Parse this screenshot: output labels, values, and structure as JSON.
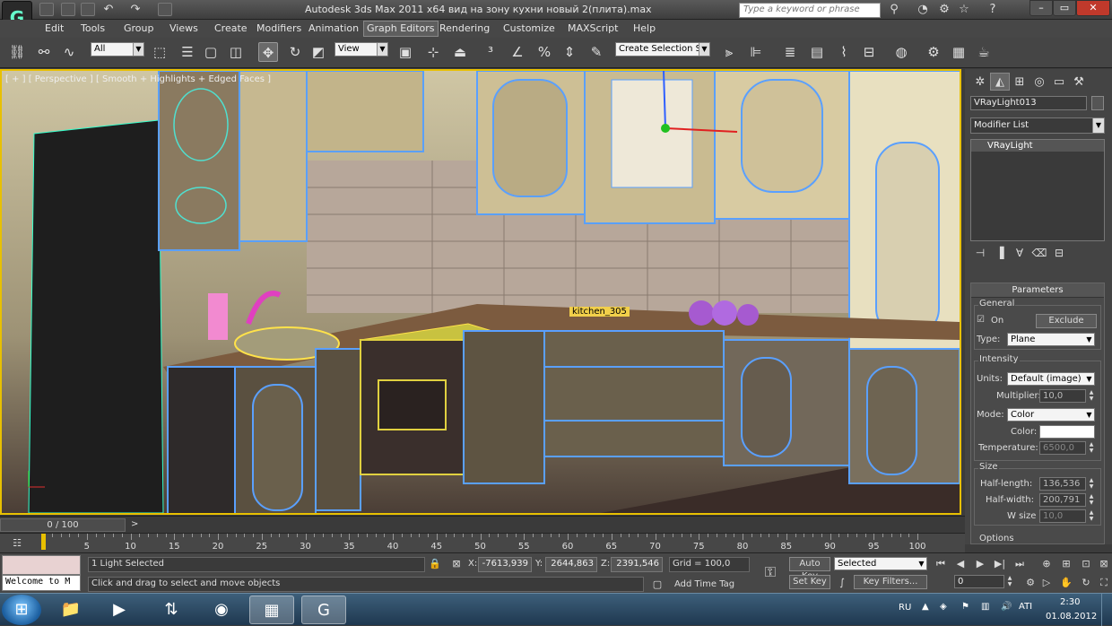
{
  "app": {
    "title": "Autodesk 3ds Max  2011 x64      вид на зону кухни новый 2(плита).max",
    "search_placeholder": "Type a keyword or phrase"
  },
  "menu": [
    {
      "label": "Edit"
    },
    {
      "label": "Tools"
    },
    {
      "label": "Group"
    },
    {
      "label": "Views"
    },
    {
      "label": "Create"
    },
    {
      "label": "Modifiers"
    },
    {
      "label": "Animation"
    },
    {
      "label": "Graph Editors"
    },
    {
      "label": "Rendering"
    },
    {
      "label": "Customize"
    },
    {
      "label": "MAXScript"
    },
    {
      "label": "Help"
    }
  ],
  "toolbar": {
    "filter_value": "All",
    "refcoord_value": "View",
    "selection_set": "Create Selection Se"
  },
  "viewport": {
    "label": "[ + ] [ Perspective ] [ Smooth + Highlights + Edged Faces ]",
    "object_tag": "kitchen_305"
  },
  "panel": {
    "object_name": "VRayLight013",
    "modifier_list": "Modifier List",
    "stack_item": "VRayLight",
    "rollout_title": "Parameters",
    "general_label": "General",
    "on_label": "On",
    "exclude_label": "Exclude",
    "type_label": "Type:",
    "type_value": "Plane",
    "intensity_label": "Intensity",
    "units_label": "Units:",
    "units_value": "Default (image)",
    "multiplier_label": "Multiplier:",
    "multiplier_value": "10,0",
    "mode_label": "Mode:",
    "mode_value": "Color",
    "color_label": "Color:",
    "temperature_label": "Temperature:",
    "temperature_value": "6500,0",
    "size_label": "Size",
    "half_length_label": "Half-length:",
    "half_length_value": "136,536",
    "half_width_label": "Half-width:",
    "half_width_value": "200,791",
    "w_size_label": "W size",
    "w_size_value": "10,0",
    "options_label": "Options"
  },
  "timeline": {
    "slider": "0 / 100",
    "ticks": [
      "0",
      "5",
      "10",
      "15",
      "20",
      "25",
      "30",
      "35",
      "40",
      "45",
      "50",
      "55",
      "60",
      "65",
      "70",
      "75",
      "80",
      "85",
      "90",
      "95",
      "100"
    ]
  },
  "status": {
    "maxscript_text": "Welcome to M",
    "selected": "1 Light Selected",
    "prompt": "Click and drag to select and move objects",
    "x_label": "X:",
    "x_value": "-7613,939",
    "y_label": "Y:",
    "y_value": "2644,863",
    "z_label": "Z:",
    "z_value": "2391,546",
    "grid": "Grid = 100,0",
    "add_time_tag": "Add Time Tag",
    "auto_key": "Auto Key",
    "key_mode": "Selected",
    "set_key": "Set Key",
    "key_filters": "Key Filters...",
    "frame": "0"
  },
  "taskbar": {
    "lang": "RU",
    "time": "2:30",
    "date": "01.08.2012"
  }
}
